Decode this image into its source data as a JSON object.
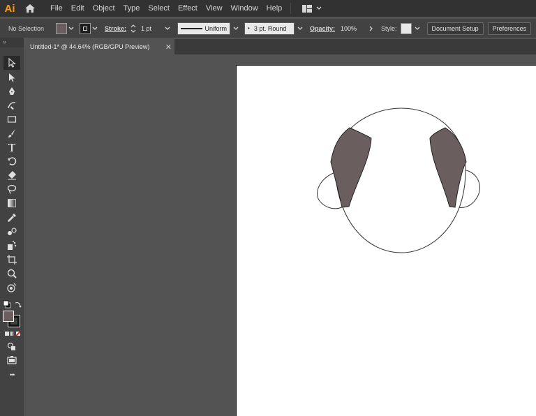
{
  "app": {
    "logo_text": "Ai"
  },
  "menu": {
    "items": [
      {
        "label": "File"
      },
      {
        "label": "Edit"
      },
      {
        "label": "Object"
      },
      {
        "label": "Type"
      },
      {
        "label": "Select"
      },
      {
        "label": "Effect"
      },
      {
        "label": "View"
      },
      {
        "label": "Window"
      },
      {
        "label": "Help"
      }
    ]
  },
  "control_bar": {
    "selection_label": "No Selection",
    "fill_color": "#6b5e5e",
    "stroke_label": "Stroke:",
    "stroke_weight": "1 pt",
    "stroke_profile": "Uniform",
    "brush_label": "3 pt. Round",
    "opacity_label": "Opacity:",
    "opacity_value": "100%",
    "style_label": "Style:",
    "document_setup_label": "Document Setup",
    "preferences_label": "Preferences"
  },
  "document_tab": {
    "title": "Untitled-1* @ 44.64% (RGB/GPU Preview)",
    "close_glyph": "✕"
  },
  "tool_panel": {
    "grip_glyph": "»",
    "more_glyph": "•••"
  },
  "artwork": {
    "shape_fill": "#6b5e5e",
    "outline_color": "#333333"
  },
  "colors": {
    "accent": "#ff9a00",
    "menubar_bg": "#323232",
    "panel_bg": "#424242",
    "pasteboard_bg": "#535353",
    "artboard_bg": "#ffffff"
  }
}
